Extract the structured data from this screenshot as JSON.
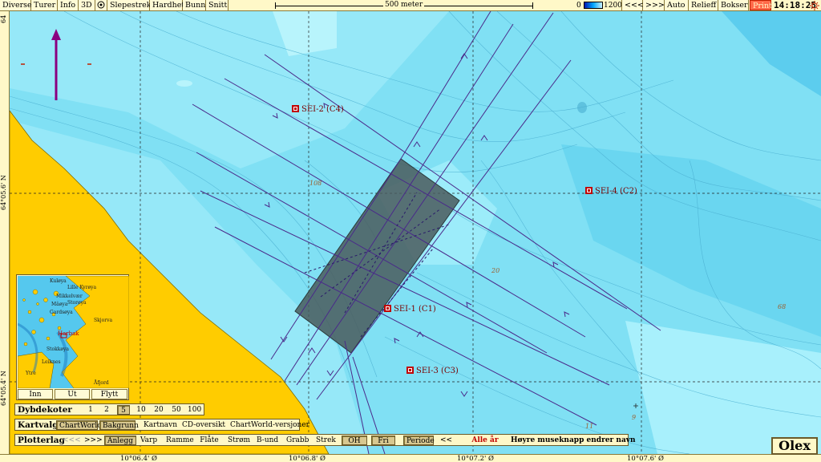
{
  "toolbar": {
    "items": [
      "Diverse",
      "Turer",
      "Info",
      "3D",
      "Slepestrek",
      "Hardhet",
      "Bunn",
      "Snitt"
    ],
    "scale_label": "500 meter",
    "depth_min": "0",
    "depth_max": "1200",
    "zoom_out": "<<<",
    "zoom_in": ">>>",
    "right_items": [
      "Auto",
      "Relieff",
      "Bokser"
    ],
    "print_label": "Print",
    "clock": "14:18:25"
  },
  "rulers": {
    "lat_labels": [
      "64°05.6' N",
      "64°05.4' N"
    ],
    "lat_top_partial": "64",
    "lon_labels": [
      "10°06.4' Ø",
      "10°06.8' Ø",
      "10°07.2' Ø",
      "10°07.6' Ø"
    ]
  },
  "map": {
    "stations": [
      {
        "label": "SEI-2 (C4)"
      },
      {
        "label": "SEI-4 (C2)"
      },
      {
        "label": "SEI-1 (C1)"
      },
      {
        "label": "SEI-3 (C3)"
      }
    ],
    "depth_labels": [
      "108",
      "20",
      "68",
      "11",
      "9"
    ],
    "colors": {
      "shallow": "#a8f0fc",
      "mid": "#80e0f4",
      "deep": "#5ccdee",
      "land": "#ffcc00",
      "track": "#4a2a8a",
      "survey_area": "#4a5a5c",
      "station": "#c00000",
      "north_arrow": "#8a0080"
    }
  },
  "inset": {
    "place_names": [
      "Kuløya",
      "Lille Kyrøya",
      "Mikkelvær",
      "Mâøya",
      "Gardsøya",
      "Storøya",
      "Skjorva",
      "Harbak",
      "Stokkøya",
      "Leiknes",
      "Ytre",
      "Åfjord"
    ],
    "buttons": [
      "Inn",
      "Ut",
      "Flytt"
    ]
  },
  "dybdekoter": {
    "label": "Dybdekoter",
    "values": [
      "1",
      "2",
      "5",
      "10",
      "20",
      "50",
      "100"
    ],
    "selected": "5"
  },
  "kartvalg": {
    "label": "Kartvalg",
    "items": [
      "ChartWorld",
      "Bakgrunn",
      "Kartnavn",
      "CD-oversikt",
      "ChartWorld-versjoner"
    ],
    "active": [
      "ChartWorld",
      "Bakgrunn"
    ]
  },
  "plotterlag": {
    "label": "Plotterlag",
    "prev": "<<<",
    "next": ">>>",
    "items": [
      "Anlegg",
      "Varp",
      "Ramme",
      "Flåte",
      "Strøm",
      "B-und",
      "Grabb",
      "Strek",
      "OH",
      "Fri",
      "Periode"
    ],
    "active": [
      "Anlegg",
      "OH",
      "Fri",
      "Periode"
    ],
    "back": "<<",
    "all_years": "Alle år",
    "hint": "Høyre museknapp endrer navn"
  },
  "brand": "Olex"
}
